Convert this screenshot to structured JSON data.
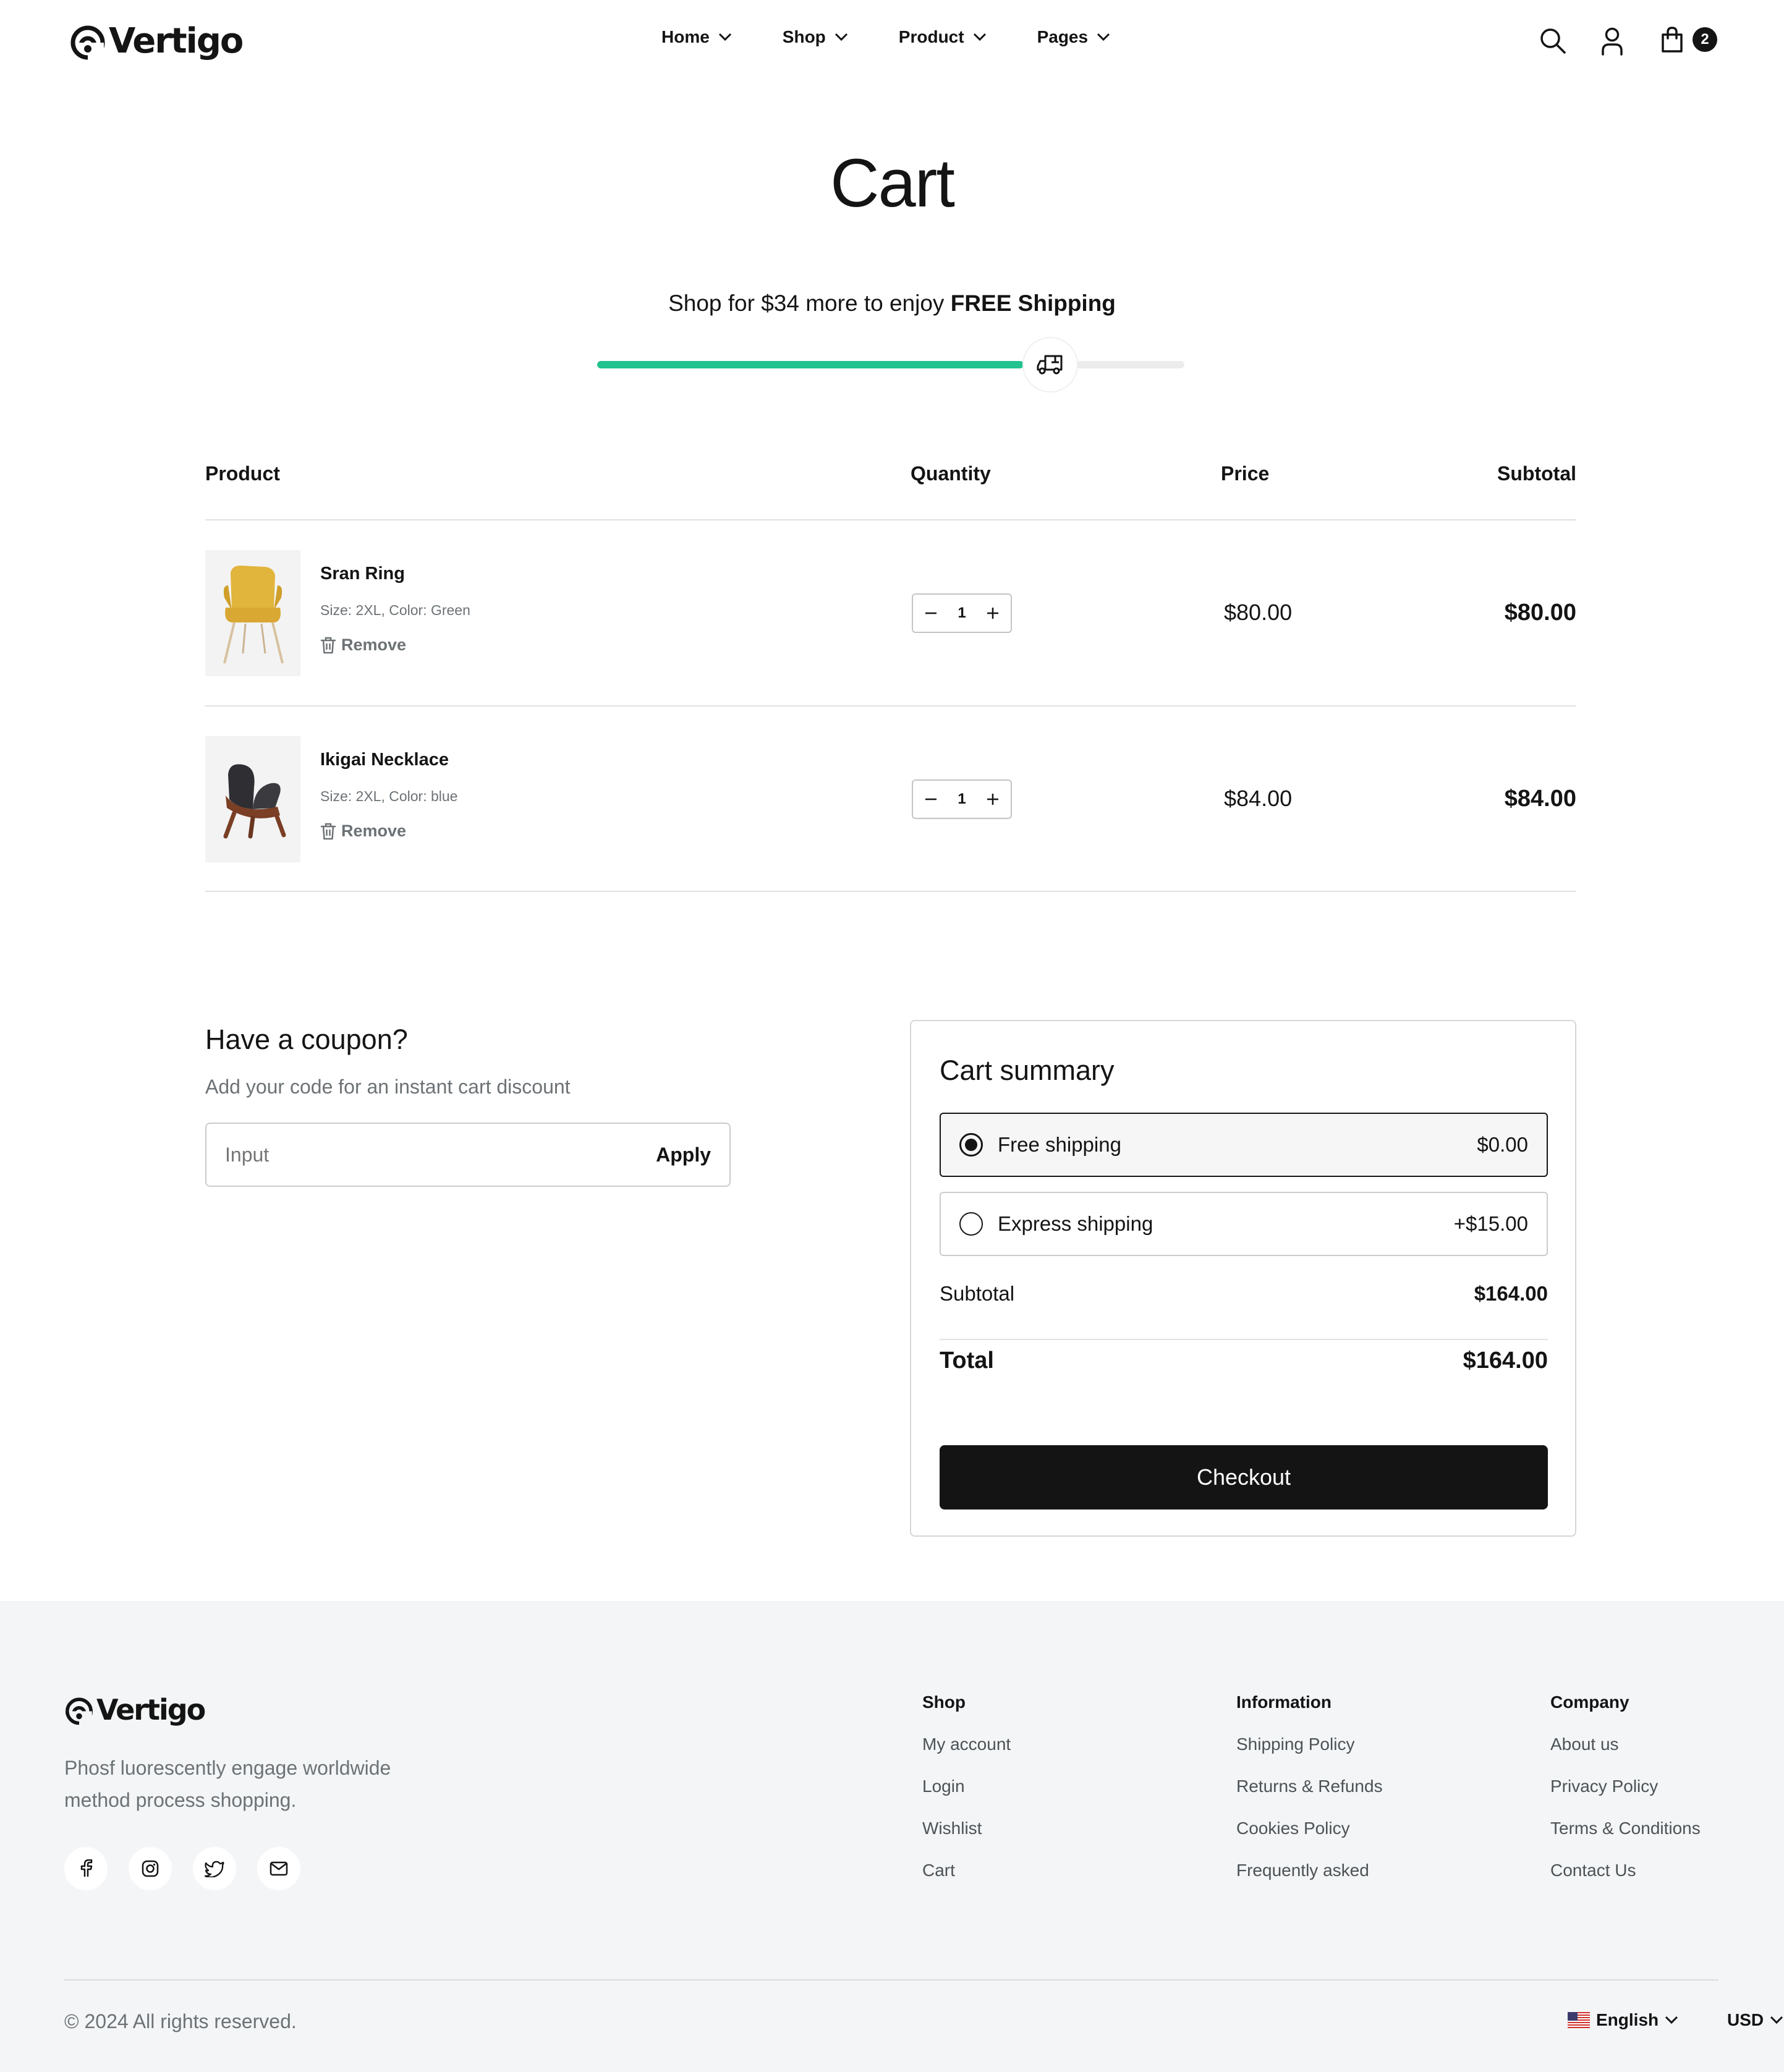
{
  "header": {
    "logo_text": "Vertigo",
    "nav": [
      "Home",
      "Shop",
      "Product",
      "Pages"
    ],
    "cart_count": "2"
  },
  "page": {
    "title": "Cart",
    "shipping_msg_prefix": "Shop for $34 more to enjoy ",
    "shipping_msg_bold": "FREE Shipping",
    "shipping_progress": 0.76
  },
  "table": {
    "headers": {
      "product": "Product",
      "quantity": "Quantity",
      "price": "Price",
      "subtotal": "Subtotal"
    },
    "items": [
      {
        "name": "Sran Ring",
        "meta": "Size: 2XL, Color: Green",
        "remove": "Remove",
        "quantity": "1",
        "price": "$80.00",
        "subtotal": "$80.00"
      },
      {
        "name": "Ikigai Necklace",
        "meta": "Size: 2XL, Color: blue",
        "remove": "Remove",
        "quantity": "1",
        "price": "$84.00",
        "subtotal": "$84.00"
      }
    ]
  },
  "coupon": {
    "title": "Have a coupon?",
    "subtitle": "Add your code for an instant cart discount",
    "placeholder": "Input",
    "apply": "Apply"
  },
  "summary": {
    "title": "Cart summary",
    "options": [
      {
        "label": "Free shipping",
        "price": "$0.00",
        "selected": true
      },
      {
        "label": "Express shipping",
        "price": "+$15.00",
        "selected": false
      }
    ],
    "subtotal_label": "Subtotal",
    "subtotal_value": "$164.00",
    "total_label": "Total",
    "total_value": "$164.00",
    "checkout": "Checkout"
  },
  "footer": {
    "logo_text": "Vertigo",
    "description_line1": "Phosf luorescently engage worldwide",
    "description_line2": "method process shopping.",
    "columns": [
      {
        "title": "Shop",
        "links": [
          "My account",
          "Login",
          "Wishlist",
          "Cart"
        ]
      },
      {
        "title": "Information",
        "links": [
          "Shipping Policy",
          "Returns & Refunds",
          "Cookies Policy",
          "Frequently asked"
        ]
      },
      {
        "title": "Company",
        "links": [
          "About us",
          "Privacy Policy",
          "Terms & Conditions",
          "Contact Us"
        ]
      }
    ],
    "copyright": "© 2024 All rights reserved.",
    "language": "English",
    "currency": "USD"
  },
  "colors": {
    "accent": "#22c38e",
    "dark": "#141414",
    "muted": "#6c7275",
    "footer_bg": "#f3f5f7"
  }
}
